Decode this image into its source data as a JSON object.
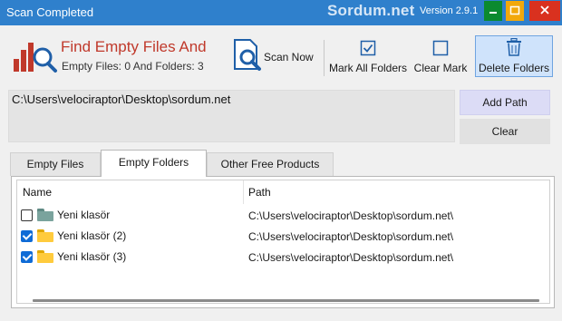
{
  "window": {
    "title": "Scan Completed",
    "watermark": "Sordum.net",
    "version": "Version 2.9.1",
    "colors": {
      "titlebar": "#2f80cc",
      "minimize": "#0b8a2f",
      "maximize": "#f2a80b",
      "close": "#d9311f"
    }
  },
  "header": {
    "app_title": "Find Empty Files And",
    "subtitle": "Empty Files: 0 And Folders: 3",
    "logo_icon": "bar-chart-magnifier-icon"
  },
  "toolbar": {
    "scan_now": "Scan Now",
    "mark_all": "Mark All Folders",
    "clear_mark": "Clear Mark",
    "delete_folders": "Delete Folders"
  },
  "path_input": {
    "value": "C:\\Users\\velociraptor\\Desktop\\sordum.net"
  },
  "side_buttons": {
    "add_path": "Add Path",
    "clear": "Clear"
  },
  "tabs": [
    {
      "label": "Empty Files",
      "active": false
    },
    {
      "label": "Empty Folders",
      "active": true
    },
    {
      "label": "Other Free Products",
      "active": false
    }
  ],
  "table": {
    "columns": [
      "Name",
      "Path"
    ],
    "rows": [
      {
        "name": "Yeni klasör",
        "path": "C:\\Users\\velociraptor\\Desktop\\sordum.net\\",
        "checked": false,
        "icon": "folder-gray-icon"
      },
      {
        "name": "Yeni klasör (2)",
        "path": "C:\\Users\\velociraptor\\Desktop\\sordum.net\\",
        "checked": true,
        "icon": "folder-yellow-icon"
      },
      {
        "name": "Yeni klasör (3)",
        "path": "C:\\Users\\velociraptor\\Desktop\\sordum.net\\",
        "checked": true,
        "icon": "folder-yellow-icon"
      }
    ]
  }
}
